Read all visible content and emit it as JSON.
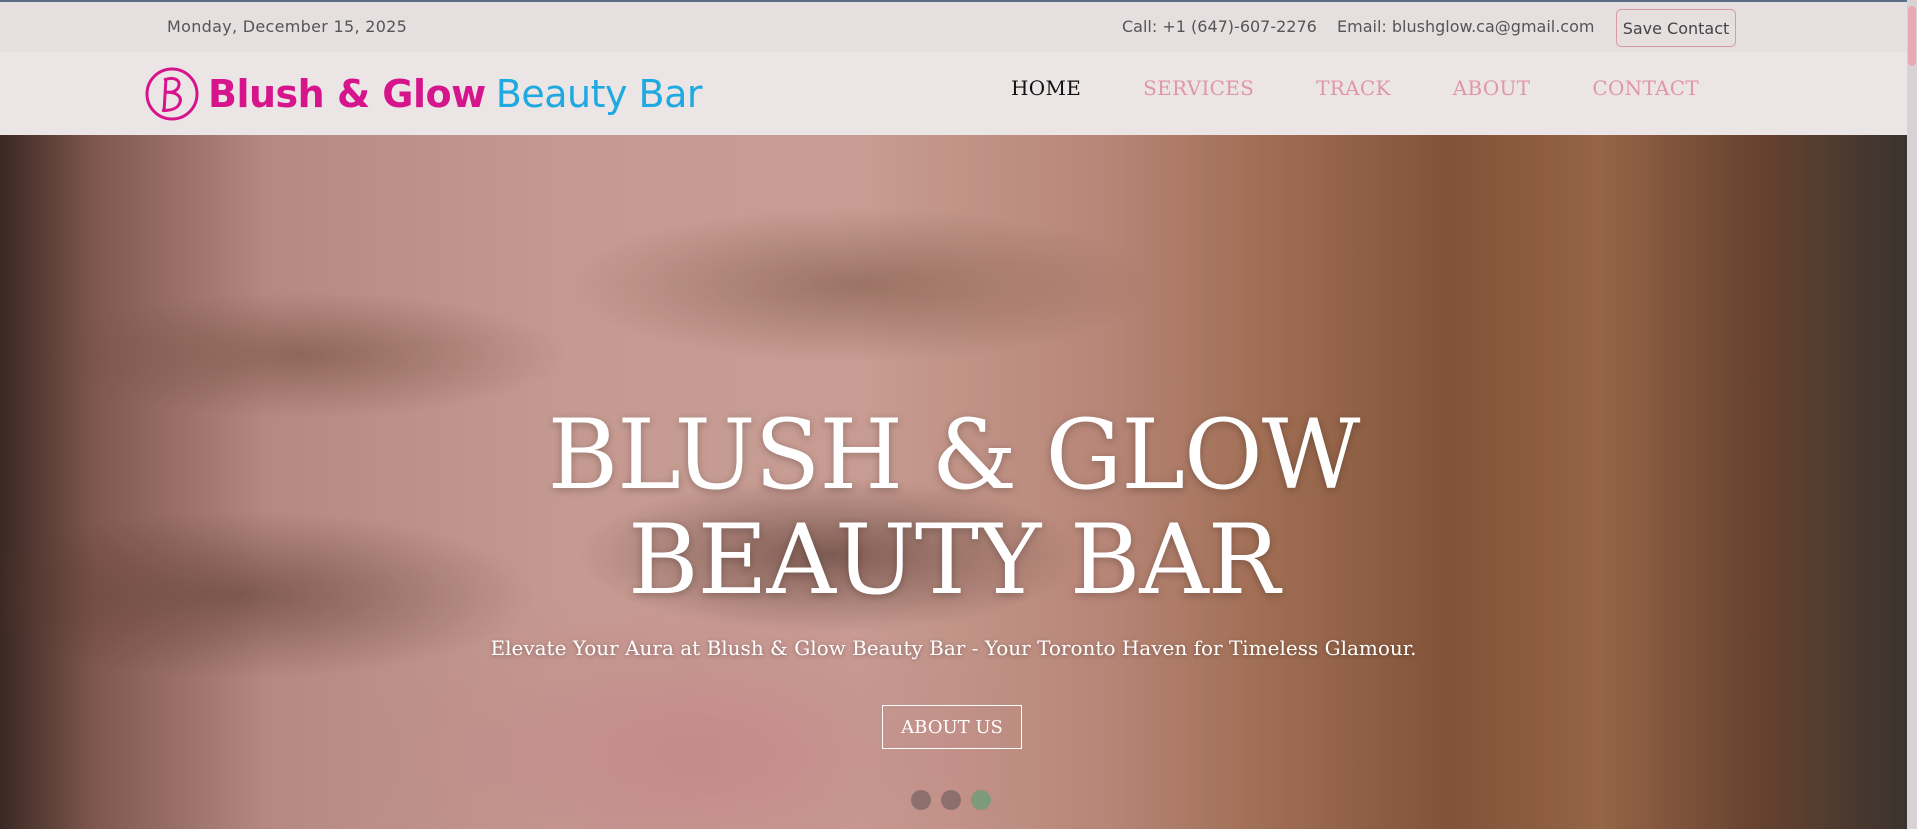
{
  "topbar": {
    "date": "Monday, December 15, 2025",
    "call": "Call: +1 (647)-607-2276",
    "email": "Email: blushglow.ca@gmail.com",
    "save_contact": "Save Contact"
  },
  "logo": {
    "name_part1": "Blush & Glow",
    "name_part2": "Beauty Bar",
    "monogram_icon": "bg-monogram-icon",
    "colors": {
      "pink": "#d6148c",
      "blue": "#1fa9e1"
    }
  },
  "nav": {
    "items": [
      {
        "label": "HOME",
        "active": true
      },
      {
        "label": "SERVICES",
        "active": false
      },
      {
        "label": "TRACK",
        "active": false
      },
      {
        "label": "ABOUT",
        "active": false
      },
      {
        "label": "CONTACT",
        "active": false
      }
    ],
    "colors": {
      "active": "#111111",
      "inactive": "#e097a6"
    }
  },
  "hero": {
    "title_line1": "BLUSH & GLOW",
    "title_line2": "BEAUTY BAR",
    "subtitle": "Elevate Your Aura at Blush & Glow Beauty Bar - Your Toronto Haven for Timeless Glamour.",
    "button": "ABOUT US",
    "slides": {
      "count": 3,
      "active_index": 2
    }
  }
}
